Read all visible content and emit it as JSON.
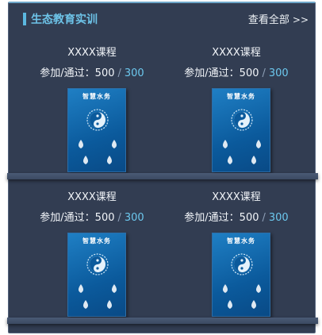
{
  "header": {
    "title": "生态教育实训",
    "more_label": "查看全部",
    "more_icon": ">>"
  },
  "stats_label": "参加/通过：",
  "stats_separator": "/",
  "courses": [
    {
      "title": "XXXX课程",
      "participants": "500",
      "passed": "300",
      "cover_title": "智慧水务"
    },
    {
      "title": "XXXX课程",
      "participants": "500",
      "passed": "300",
      "cover_title": "智慧水务"
    },
    {
      "title": "XXXX课程",
      "participants": "500",
      "passed": "300",
      "cover_title": "智慧水务"
    },
    {
      "title": "XXXX课程",
      "participants": "500",
      "passed": "300",
      "cover_title": "智慧水务"
    }
  ],
  "colors": {
    "panel_bg": "#323d52",
    "accent": "#6dc3e8",
    "passed_value": "#6cc8ee",
    "book_blue": "#0b5a9c"
  }
}
